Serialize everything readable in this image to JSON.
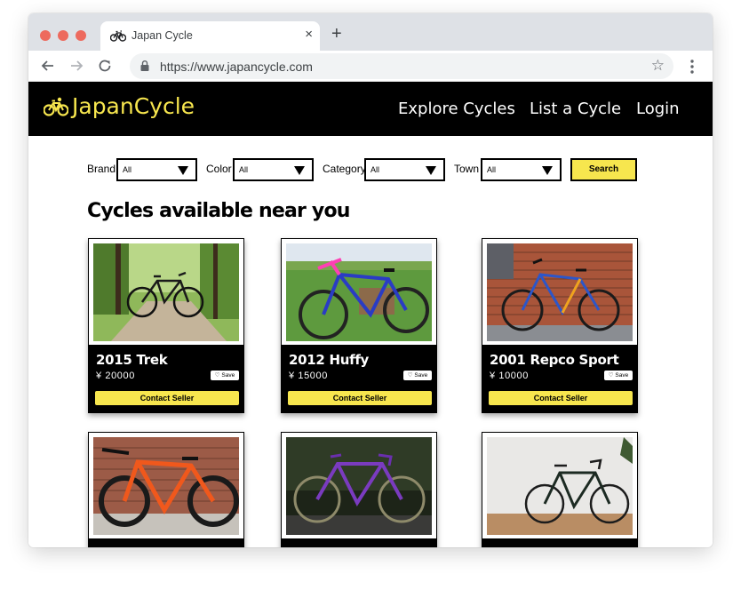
{
  "browser": {
    "tab_title": "Japan Cycle",
    "tab_close": "×",
    "new_tab": "+",
    "url": "https://www.japancycle.com",
    "bookmark_star": "☆"
  },
  "site": {
    "logo": "JapanCycle",
    "nav": [
      "Explore Cycles",
      "List a Cycle",
      "Login"
    ],
    "brand_color": "#f7e64e"
  },
  "filters": {
    "brand_label": "Brand",
    "brand_value": "All",
    "color_label": "Color",
    "color_value": "All",
    "category_label": "Category",
    "category_value": "All",
    "town_label": "Town",
    "town_value": "All",
    "search_label": "Search"
  },
  "section_title": "Cycles available near you",
  "cards": [
    {
      "name": "2015 Trek",
      "price": "¥ 20000",
      "save": "♡ Save",
      "contact": "Contact Seller"
    },
    {
      "name": "2012 Huffy",
      "price": "¥ 15000",
      "save": "♡ Save",
      "contact": "Contact Seller"
    },
    {
      "name": "2001 Repco Sport",
      "price": "¥ 10000",
      "save": "♡ Save",
      "contact": "Contact Seller"
    },
    {
      "name": "",
      "price": "",
      "save": "",
      "contact": ""
    },
    {
      "name": "",
      "price": "",
      "save": "",
      "contact": ""
    },
    {
      "name": "",
      "price": "",
      "save": "",
      "contact": ""
    }
  ]
}
